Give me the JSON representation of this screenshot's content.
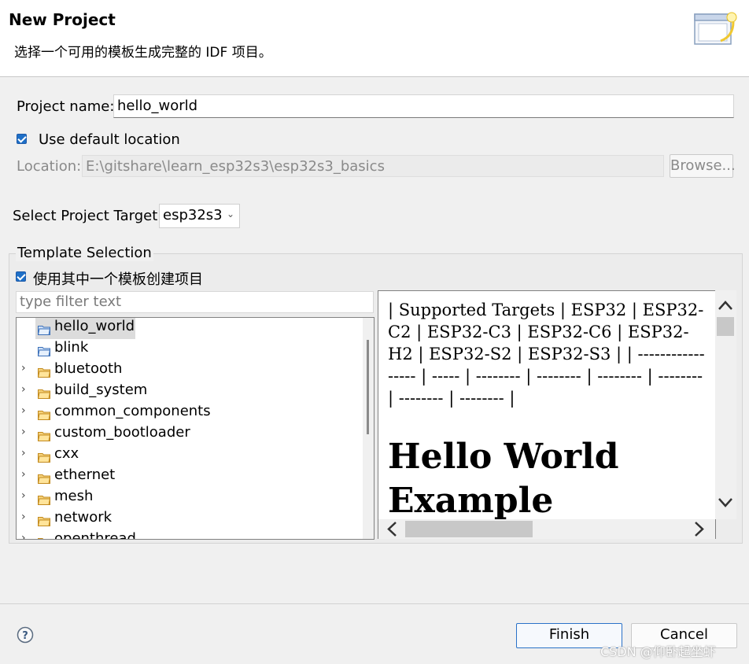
{
  "header": {
    "title": "New Project",
    "description": "选择一个可用的模板生成完整的 IDF 项目。"
  },
  "project": {
    "name_label": "Project name:",
    "name_value": "hello_world",
    "use_default_location_label": "Use default location",
    "use_default_location_checked": true,
    "location_label": "Location:",
    "location_value": "E:\\gitshare\\learn_esp32s3\\esp32s3_basics",
    "browse_label": "Browse...",
    "target_label": "Select Project Target:",
    "target_value": "esp32s3"
  },
  "templates": {
    "group_title": "Template Selection",
    "use_template_label": "使用其中一个模板创建项目",
    "use_template_checked": true,
    "filter_placeholder": "type filter text",
    "items": [
      {
        "name": "hello_world",
        "expandable": false,
        "selected": true
      },
      {
        "name": "blink",
        "expandable": false,
        "selected": false
      },
      {
        "name": "bluetooth",
        "expandable": true,
        "selected": false
      },
      {
        "name": "build_system",
        "expandable": true,
        "selected": false
      },
      {
        "name": "common_components",
        "expandable": true,
        "selected": false
      },
      {
        "name": "custom_bootloader",
        "expandable": true,
        "selected": false
      },
      {
        "name": "cxx",
        "expandable": true,
        "selected": false
      },
      {
        "name": "ethernet",
        "expandable": true,
        "selected": false
      },
      {
        "name": "mesh",
        "expandable": true,
        "selected": false
      },
      {
        "name": "network",
        "expandable": true,
        "selected": false
      },
      {
        "name": "openthread",
        "expandable": true,
        "selected": false
      }
    ]
  },
  "preview": {
    "text": "| Supported Targets | ESP32 | ESP32-C2 | ESP32-C3 | ESP32-C6 | ESP32-H2 | ESP32-S2 | ESP32-S3 | | ----------------- | ----- | -------- | -------- | -------- | -------- | -------- | -------- |",
    "heading": "Hello World Example"
  },
  "footer": {
    "finish_label": "Finish",
    "cancel_label": "Cancel",
    "watermark": "CSDN @仰卧起坐虾"
  },
  "colors": {
    "accent": "#1e6fc7",
    "selection": "#dcdcdc"
  }
}
